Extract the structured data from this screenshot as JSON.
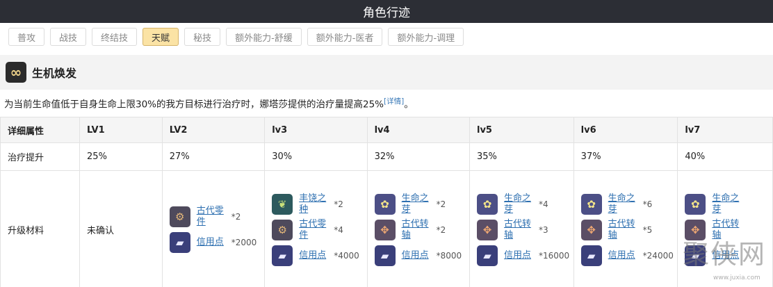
{
  "page": {
    "title": "角色行迹"
  },
  "tabs": [
    {
      "label": "普攻",
      "active": false
    },
    {
      "label": "战技",
      "active": false
    },
    {
      "label": "终结技",
      "active": false
    },
    {
      "label": "天赋",
      "active": true
    },
    {
      "label": "秘技",
      "active": false
    },
    {
      "label": "额外能力-舒缓",
      "active": false
    },
    {
      "label": "额外能力-医者",
      "active": false
    },
    {
      "label": "额外能力-调理",
      "active": false
    }
  ],
  "skill": {
    "name": "生机焕发",
    "icon": "infinity-icon",
    "description": "为当前生命值低于自身生命上限30%的我方目标进行治疗时，娜塔莎提供的治疗量提高25%",
    "detail_link": "[详情]",
    "description_end": "。"
  },
  "table": {
    "header_label": "详细属性",
    "levels": [
      "LV1",
      "LV2",
      "lv3",
      "lv4",
      "lv5",
      "lv6",
      "lv7"
    ],
    "heal_row": {
      "label": "治疗提升",
      "values": [
        "25%",
        "27%",
        "30%",
        "32%",
        "35%",
        "37%",
        "40%"
      ]
    },
    "materials_row": {
      "label": "升级材料",
      "lv1_text": "未确认",
      "materials": [
        [],
        [
          {
            "name": "古代零件",
            "count": "*2",
            "icon": "gear-icon"
          },
          {
            "name": "信用点",
            "count": "*2000",
            "icon": "credit-icon"
          }
        ],
        [
          {
            "name": "丰饶之种",
            "count": "*2",
            "icon": "seed-icon"
          },
          {
            "name": "古代零件",
            "count": "*4",
            "icon": "gear-icon"
          },
          {
            "name": "信用点",
            "count": "*4000",
            "icon": "credit-icon"
          }
        ],
        [
          {
            "name": "生命之芽",
            "count": "*2",
            "icon": "bloom-icon"
          },
          {
            "name": "古代转轴",
            "count": "*2",
            "icon": "axis-icon"
          },
          {
            "name": "信用点",
            "count": "*8000",
            "icon": "credit-icon"
          }
        ],
        [
          {
            "name": "生命之芽",
            "count": "*4",
            "icon": "bloom-icon"
          },
          {
            "name": "古代转轴",
            "count": "*3",
            "icon": "axis-icon"
          },
          {
            "name": "信用点",
            "count": "*16000",
            "icon": "credit-icon"
          }
        ],
        [
          {
            "name": "生命之芽",
            "count": "*6",
            "icon": "bloom-icon"
          },
          {
            "name": "古代转轴",
            "count": "*5",
            "icon": "axis-icon"
          },
          {
            "name": "信用点",
            "count": "*24000",
            "icon": "credit-icon"
          }
        ],
        [
          {
            "name": "生命之芽",
            "count": "",
            "icon": "bloom-icon"
          },
          {
            "name": "古代转轴",
            "count": "",
            "icon": "axis-icon"
          },
          {
            "name": "信用点",
            "count": "",
            "icon": "credit-icon"
          }
        ]
      ]
    }
  },
  "watermark": {
    "text": "聚侠网",
    "url": "www.juxia.com"
  },
  "colors": {
    "title_bg": "#2c2e35",
    "active_tab": "#fbe3a5",
    "link": "#2d6fb0"
  }
}
